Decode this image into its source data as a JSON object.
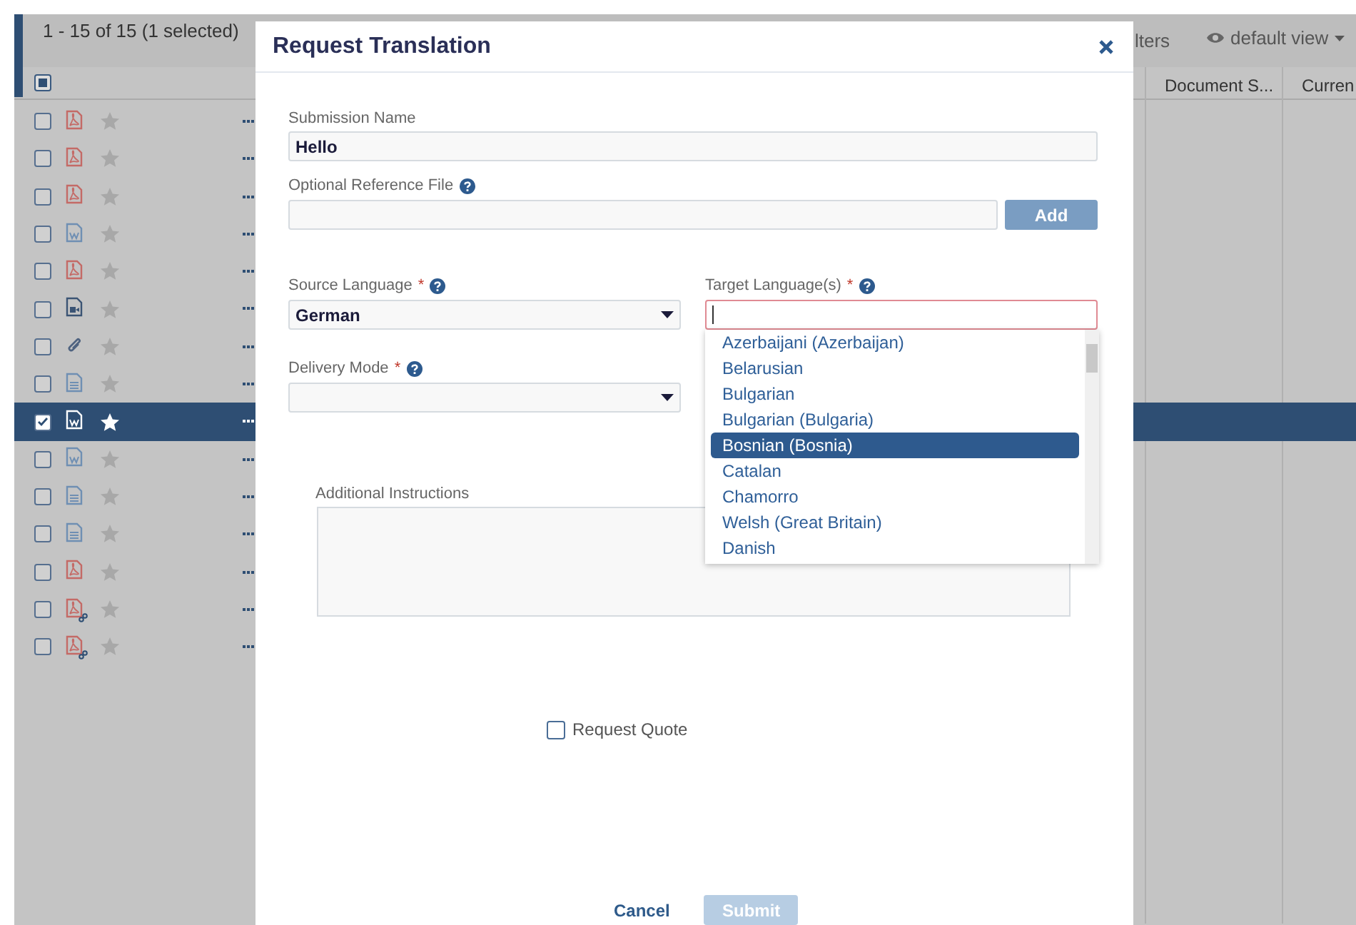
{
  "toolbar": {
    "count": "1 - 15 of 15 (1 selected)",
    "filters": "lters",
    "view": "default view"
  },
  "header_checkbox": {
    "indeterminate": true
  },
  "columns": [
    "Document S...",
    "Curren"
  ],
  "rows": [
    {
      "kind": "pdf",
      "checked": false,
      "starred": false,
      "selected": false
    },
    {
      "kind": "pdf",
      "checked": false,
      "starred": false,
      "selected": false
    },
    {
      "kind": "pdf",
      "checked": false,
      "starred": false,
      "selected": false
    },
    {
      "kind": "word",
      "checked": false,
      "starred": false,
      "selected": false
    },
    {
      "kind": "pdf",
      "checked": false,
      "starred": false,
      "selected": false
    },
    {
      "kind": "video",
      "checked": false,
      "starred": false,
      "selected": false
    },
    {
      "kind": "attachment",
      "checked": false,
      "starred": false,
      "selected": false
    },
    {
      "kind": "text",
      "checked": false,
      "starred": false,
      "selected": false
    },
    {
      "kind": "word",
      "checked": true,
      "starred": true,
      "selected": true
    },
    {
      "kind": "word",
      "checked": false,
      "starred": false,
      "selected": false
    },
    {
      "kind": "text",
      "checked": false,
      "starred": false,
      "selected": false
    },
    {
      "kind": "text",
      "checked": false,
      "starred": false,
      "selected": false
    },
    {
      "kind": "pdf",
      "checked": false,
      "starred": false,
      "selected": false
    },
    {
      "kind": "pdf-link",
      "checked": false,
      "starred": false,
      "selected": false
    },
    {
      "kind": "pdf-link",
      "checked": false,
      "starred": false,
      "selected": false
    }
  ],
  "dialog": {
    "title": "Request Translation",
    "submission_name": {
      "label": "Submission Name",
      "value": "Hello"
    },
    "reference_file": {
      "label": "Optional Reference File",
      "button": "Add"
    },
    "source_language": {
      "label": "Source Language",
      "required": "*",
      "value": "German"
    },
    "target_language": {
      "label": "Target Language(s)",
      "required": "*",
      "options": [
        {
          "label": "Azerbaijani (Azerbaijan)",
          "selected": false
        },
        {
          "label": "Belarusian",
          "selected": false
        },
        {
          "label": "Bulgarian",
          "selected": false
        },
        {
          "label": "Bulgarian (Bulgaria)",
          "selected": false
        },
        {
          "label": "Bosnian (Bosnia)",
          "selected": true
        },
        {
          "label": "Catalan",
          "selected": false
        },
        {
          "label": "Chamorro",
          "selected": false
        },
        {
          "label": "Welsh (Great Britain)",
          "selected": false
        },
        {
          "label": "Danish",
          "selected": false
        }
      ]
    },
    "delivery_mode": {
      "label": "Delivery Mode",
      "required": "*"
    },
    "instructions": {
      "label": "Additional Instructions"
    },
    "request_quote": {
      "label": "Request Quote",
      "checked": false
    },
    "cancel": "Cancel",
    "submit": "Submit"
  }
}
